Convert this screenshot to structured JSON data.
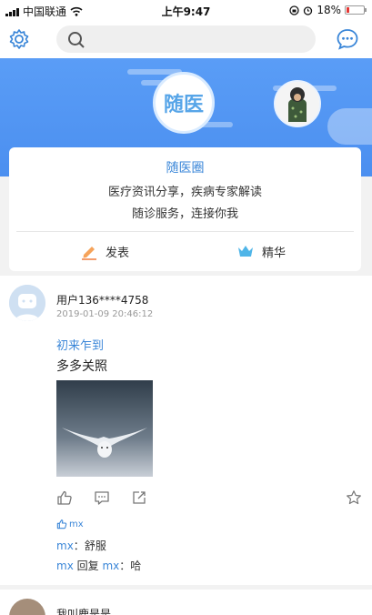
{
  "status_bar": {
    "carrier": "中国联通",
    "time": "上午9:47",
    "battery": "18%",
    "battery_level": 0.18
  },
  "header": {
    "settings_icon": "gear-icon",
    "search_icon": "search-icon",
    "message_icon": "chat-bubble-icon"
  },
  "banner": {
    "logo_text": "随医"
  },
  "circle": {
    "title": "随医圈",
    "line1": "医疗资讯分享，疾病专家解读",
    "line2": "随诊服务，连接你我",
    "publish_label": "发表",
    "featured_label": "精华",
    "accent": "#3a86d8"
  },
  "post": {
    "username": "用户136****4758",
    "time": "2019-01-09 20:46:12",
    "tag": "初来乍到",
    "text": "多多关照",
    "likes": "mx",
    "comments": [
      {
        "author": "mx",
        "sep": "：",
        "content": "舒服"
      },
      {
        "author": "mx",
        "reply_word": " 回复 ",
        "target": "mx",
        "sep": "：",
        "content": "哈"
      }
    ]
  },
  "next_post": {
    "username": "我叫鹿是是"
  }
}
